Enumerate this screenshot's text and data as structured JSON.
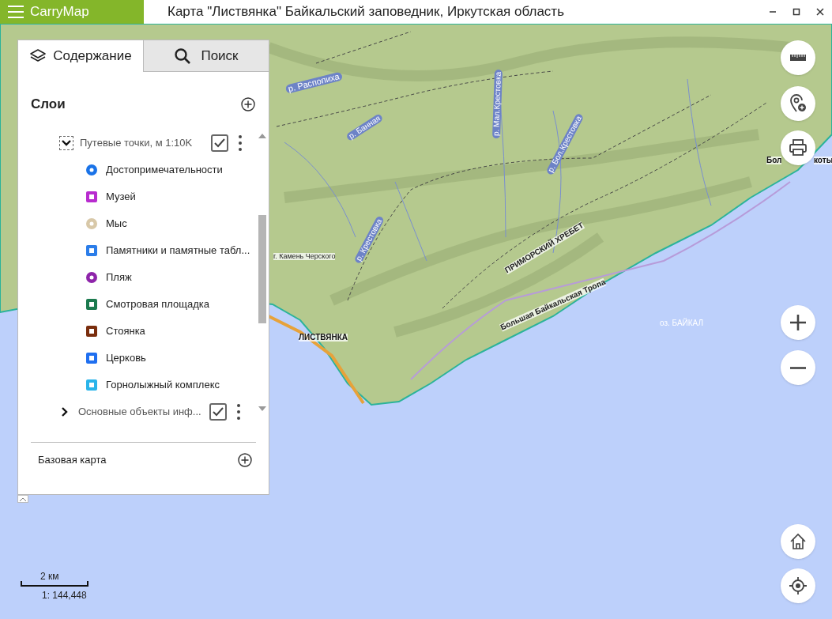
{
  "app": {
    "name": "CarryMap",
    "title": "Карта \"Листвянка\" Байкальский заповедник,  Иркутская область"
  },
  "tabs": [
    {
      "label": "Содержание",
      "selected": true,
      "kind": "layers"
    },
    {
      "label": "Поиск",
      "selected": false,
      "kind": "search"
    }
  ],
  "layers": {
    "heading": "Слои",
    "groups": [
      {
        "name": "Путевые точки, м 1:10K",
        "expanded": true,
        "checked": true,
        "children": [
          {
            "name": "Достопримечательности",
            "kind": "circle",
            "color": "#1a73e8"
          },
          {
            "name": "Музей",
            "kind": "square",
            "color": "#b82ccf"
          },
          {
            "name": "Мыс",
            "kind": "circle",
            "color": "#d8c8a8"
          },
          {
            "name": "Памятники и памятные табл...",
            "kind": "square",
            "color": "#2b7de9"
          },
          {
            "name": "Пляж",
            "kind": "circle",
            "color": "#8e24aa"
          },
          {
            "name": "Смотровая площадка",
            "kind": "square",
            "color": "#1b7a4e"
          },
          {
            "name": "Стоянка",
            "kind": "square",
            "color": "#7a2e0e"
          },
          {
            "name": "Церковь",
            "kind": "square",
            "color": "#1f6ff0"
          },
          {
            "name": "Горнолыжный комплекс",
            "kind": "square",
            "color": "#2ab4ea"
          }
        ]
      },
      {
        "name": "Основные объекты инф...",
        "expanded": false,
        "checked": true
      }
    ]
  },
  "base_map": {
    "label": "Базовая карта"
  },
  "map_labels": [
    "р. Распопиха",
    "р. Банная",
    "р. Мал.Крестовка",
    "р. Бол.Крестовка",
    "р. Крестовка",
    "г. Камень Черского",
    "ЛИСТВЯНКА",
    "ПРИМОРСКИЙ ХРЕБЕТ",
    "Большая Байкальская Тропа",
    "оз. БАЙКАЛ",
    "Бол",
    "коты"
  ],
  "scale": {
    "distance": "2 км",
    "ratio": "1: 144,448"
  }
}
